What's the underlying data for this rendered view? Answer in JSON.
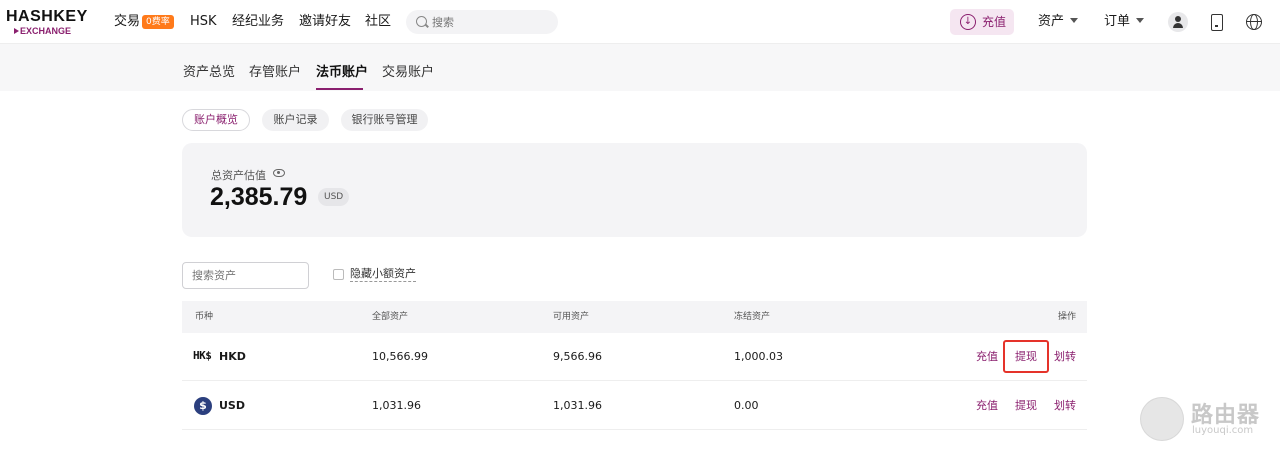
{
  "brand": {
    "logo_top": "HASHKEY",
    "logo_bottom": "EXCHANGE"
  },
  "nav": {
    "items": [
      "交易",
      "HSK",
      "经纪业务",
      "邀请好友",
      "社区"
    ],
    "trade_badge": "0费率",
    "search_placeholder": "搜索",
    "deposit_label": "充值",
    "assets_label": "资产",
    "orders_label": "订单"
  },
  "subtabs": {
    "items": [
      "资产总览",
      "存管账户",
      "法币账户",
      "交易账户"
    ],
    "active": "法币账户"
  },
  "pills": {
    "items": [
      "账户概览",
      "账户记录",
      "银行账号管理"
    ],
    "active": "账户概览"
  },
  "summary": {
    "label": "总资产估值",
    "value": "2,385.79",
    "currency": "USD"
  },
  "filters": {
    "search_placeholder": "搜索资产",
    "hide_small_label": "隐藏小额资产"
  },
  "table": {
    "headers": [
      "币种",
      "全部资产",
      "可用资产",
      "冻结资产",
      "操作"
    ],
    "rows": [
      {
        "coin": "HKD",
        "coin_icon": "HK$",
        "total": "10,566.99",
        "available": "9,566.96",
        "frozen": "1,000.03",
        "actions": [
          "充值",
          "提现",
          "划转"
        ]
      },
      {
        "coin": "USD",
        "coin_icon": "$",
        "total": "1,031.96",
        "available": "1,031.96",
        "frozen": "0.00",
        "actions": [
          "充值",
          "提现",
          "划转"
        ]
      }
    ]
  },
  "watermark": {
    "title": "路由器",
    "subtitle": "luyouqi.com"
  },
  "colors": {
    "accent": "#8a1f6e",
    "badge": "#ff7a1a",
    "highlight": "#e5332a"
  }
}
